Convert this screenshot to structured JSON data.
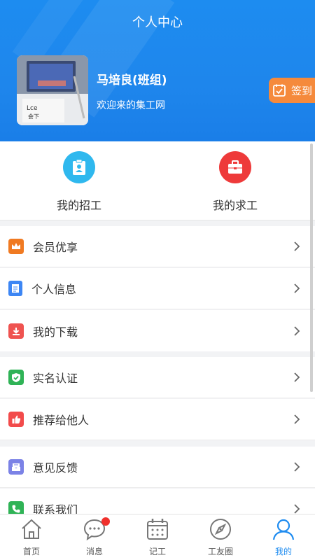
{
  "header": {
    "title": "个人中心",
    "user_name": "马培良(班组)",
    "welcome": "欢迎来的集工网",
    "signin_label": "签到",
    "avatar_text": "Lce 会下"
  },
  "quick": {
    "recruit_label": "我的招工",
    "job_label": "我的求工"
  },
  "menu": {
    "items": [
      {
        "label": "会员优享",
        "icon": "crown-icon",
        "color": "#f07a22"
      },
      {
        "label": "个人信息",
        "icon": "document-icon",
        "color": "#3d86f4"
      },
      {
        "label": "我的下载",
        "icon": "download-icon",
        "color": "#ef5350"
      },
      {
        "label": "实名认证",
        "icon": "shield-check-icon",
        "color": "#2fb356"
      },
      {
        "label": "推荐给他人",
        "icon": "thumbs-up-icon",
        "color": "#f24b4b"
      },
      {
        "label": "意见反馈",
        "icon": "feedback-icon",
        "color": "#7b82e6"
      },
      {
        "label": "联系我们",
        "icon": "phone-icon",
        "color": "#2fb356"
      }
    ]
  },
  "tabbar": {
    "home": "首页",
    "messages": "消息",
    "record": "记工",
    "workmates": "工友圈",
    "mine": "我的"
  },
  "colors": {
    "primary": "#1d8cf0",
    "signin": "#f58a3c"
  }
}
